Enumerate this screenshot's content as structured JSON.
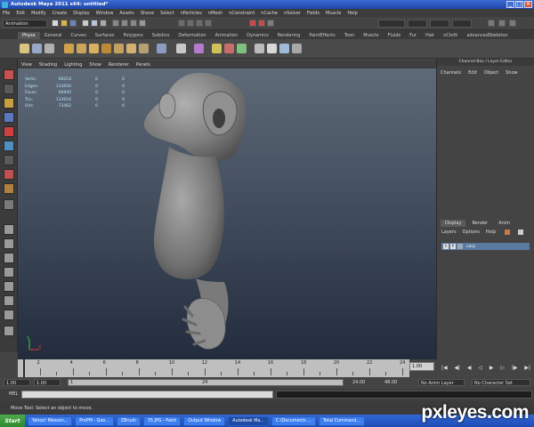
{
  "window": {
    "title": "Autodesk Maya 2011 x64: untitled*"
  },
  "menubar": [
    "File",
    "Edit",
    "Modify",
    "Create",
    "Display",
    "Window",
    "Assets",
    "Shave",
    "Select",
    "nParticles",
    "nMesh",
    "nConstraint",
    "nCache",
    "nSolver",
    "Fields",
    "Muscle",
    "Help"
  ],
  "statusline": {
    "mode": "Animation"
  },
  "shelf_tabs": [
    {
      "label": "Physx",
      "active": true
    },
    {
      "label": "General"
    },
    {
      "label": "Curves"
    },
    {
      "label": "Surfaces"
    },
    {
      "label": "Polygons"
    },
    {
      "label": "Subdivs"
    },
    {
      "label": "Deformation"
    },
    {
      "label": "Animation"
    },
    {
      "label": "Dynamics"
    },
    {
      "label": "Rendering"
    },
    {
      "label": "PaintEffects"
    },
    {
      "label": "Toon"
    },
    {
      "label": "Muscle"
    },
    {
      "label": "Fluids"
    },
    {
      "label": "Fur"
    },
    {
      "label": "Hair"
    },
    {
      "label": "nCloth"
    },
    {
      "label": "advancedSkeleton"
    }
  ],
  "viewport": {
    "menu": [
      "View",
      "Shading",
      "Lighting",
      "Show",
      "Renderer",
      "Panels"
    ],
    "hud": [
      {
        "label": "Verts:",
        "value": "66018",
        "c1": "0",
        "c2": "0"
      },
      {
        "label": "Edges:",
        "value": "133656",
        "c1": "0",
        "c2": "0"
      },
      {
        "label": "Faces:",
        "value": "66840",
        "c1": "0",
        "c2": "0"
      },
      {
        "label": "Tris:",
        "value": "133616",
        "c1": "0",
        "c2": "0"
      },
      {
        "label": "UVs:",
        "value": "73462",
        "c1": "0",
        "c2": "0"
      }
    ],
    "axis": {
      "y": "Y",
      "x": "X"
    }
  },
  "channel_box": {
    "title": "Channel Box / Layer Editor",
    "menu": [
      "Channels",
      "Edit",
      "Object",
      "Show"
    ]
  },
  "layer_editor": {
    "tabs": [
      {
        "label": "Display",
        "active": true
      },
      {
        "label": "Render"
      },
      {
        "label": "Anim"
      }
    ],
    "menu": [
      "Layers",
      "Options",
      "Help"
    ],
    "layer": {
      "v": "V",
      "p": "P",
      "name": "corp"
    }
  },
  "time_slider": {
    "ticks": [
      "2",
      "4",
      "6",
      "8",
      "10",
      "12",
      "14",
      "16",
      "18",
      "20",
      "22",
      "24"
    ],
    "current_time": "1.00"
  },
  "range_slider": {
    "start": "1.00",
    "playback_start": "1.00",
    "bar_start": "1",
    "bar_end": "24",
    "playback_end": "24.00",
    "end": "48.00",
    "anim_layer": "No Anim Layer",
    "character_set": "No Character Set"
  },
  "command_line": {
    "label": "MEL"
  },
  "help_line": {
    "text": "Move Tool: Select an object to move."
  },
  "taskbar": {
    "start": "Start",
    "tasks": [
      {
        "label": "Yahoo! Messen..."
      },
      {
        "label": "ProPM - Goo..."
      },
      {
        "label": "ZBrush"
      },
      {
        "label": "35.JPG - Paint"
      },
      {
        "label": "Output Window"
      },
      {
        "label": "Autodesk Ma...",
        "active": true
      },
      {
        "label": "C:\\Documents ..."
      },
      {
        "label": "Total Command..."
      }
    ]
  },
  "watermark": "pxleyes.com",
  "colors": {
    "title_bar": "#2956c2",
    "viewport_top": "#5f6a78",
    "viewport_bottom": "#222c3d",
    "model": "#8a8a8a",
    "hud_text": "#b7e3ff",
    "layer_highlight": "#5b7aa0"
  }
}
